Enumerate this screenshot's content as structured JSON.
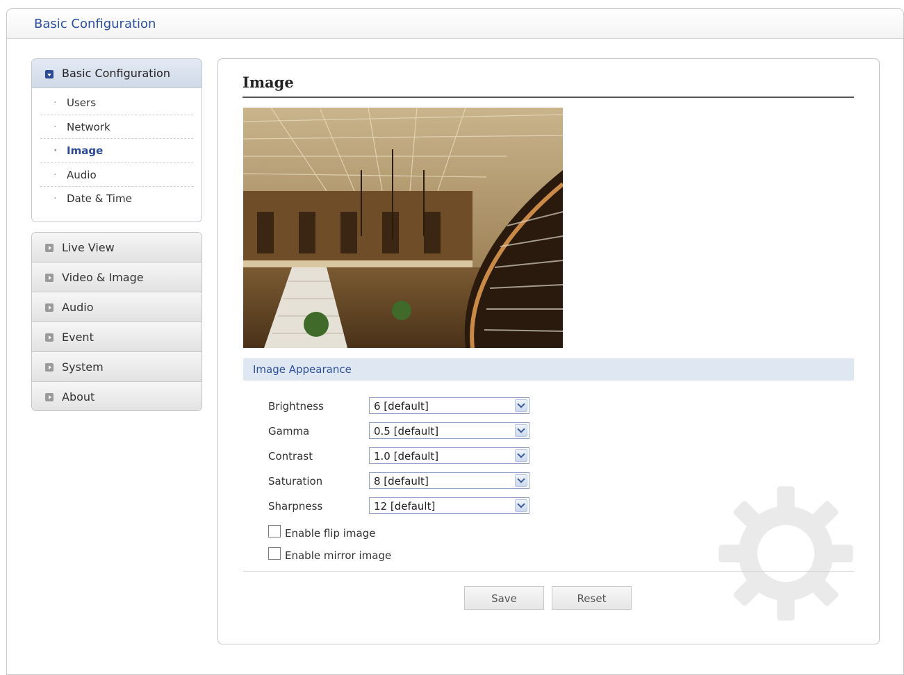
{
  "header": {
    "title": "Basic Configuration"
  },
  "sidebar": {
    "basic": {
      "title": "Basic Configuration",
      "items": [
        {
          "label": "Users"
        },
        {
          "label": "Network"
        },
        {
          "label": "Image",
          "active": true
        },
        {
          "label": "Audio"
        },
        {
          "label": "Date & Time"
        }
      ]
    },
    "menu": [
      {
        "label": "Live View"
      },
      {
        "label": "Video & Image"
      },
      {
        "label": "Audio"
      },
      {
        "label": "Event"
      },
      {
        "label": "System"
      },
      {
        "label": "About"
      }
    ]
  },
  "main": {
    "title": "Image",
    "section_title": "Image Appearance",
    "fields": [
      {
        "label": "Brightness",
        "value": "6 [default]"
      },
      {
        "label": "Gamma",
        "value": "0.5 [default]"
      },
      {
        "label": "Contrast",
        "value": "1.0 [default]"
      },
      {
        "label": "Saturation",
        "value": "8 [default]"
      },
      {
        "label": "Sharpness",
        "value": "12 [default]"
      }
    ],
    "checkboxes": [
      {
        "label": "Enable flip image",
        "checked": false
      },
      {
        "label": "Enable mirror image",
        "checked": false
      }
    ],
    "buttons": {
      "save": "Save",
      "reset": "Reset"
    }
  },
  "colors": {
    "accent": "#2c4f9e",
    "section_bar": "#dfe7f2",
    "menu_gray": "#e2e2e2"
  },
  "icons": {
    "sidebar_open": "expand-down-icon",
    "sidebar_closed": "expand-right-icon",
    "select_arrow": "chevron-down-icon",
    "background": "gear-icon"
  }
}
